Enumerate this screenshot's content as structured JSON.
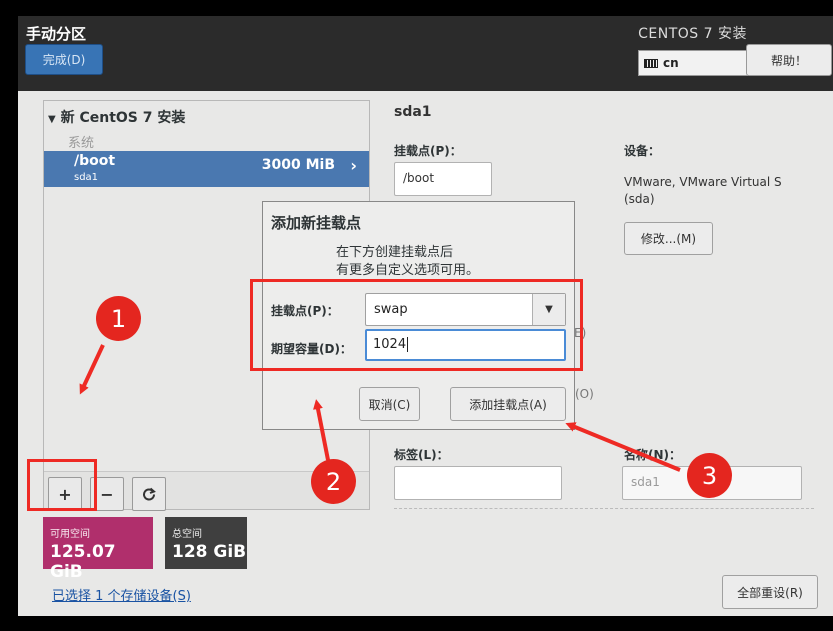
{
  "header": {
    "title": "手动分区",
    "done_label": "完成(D)",
    "product_title": "CENTOS 7 安装",
    "keyboard_layout": "cn",
    "help_label": "帮助！"
  },
  "left_panel": {
    "group_title": "新 CentOS 7 安装",
    "section_label": "系统",
    "selected_row": {
      "mount": "/boot",
      "device": "sda1",
      "size": "3000 MiB"
    },
    "tools": {
      "add": "+",
      "remove": "−"
    }
  },
  "space": {
    "available_label": "可用空间",
    "available_value": "125.07 GiB",
    "total_label": "总空间",
    "total_value": "128 GiB"
  },
  "storage_link": "已选择 1 个存储设备(S)",
  "reset_label": "全部重设(R)",
  "right_panel": {
    "title": "sda1",
    "mount_label": "挂载点(P)：",
    "mount_value": "/boot",
    "device_label": "设备：",
    "device_desc_line1": "VMware, VMware Virtual S",
    "device_desc_line2": "(sda)",
    "modify_label": "修改...(M)",
    "frag_e": "E)",
    "frag_o": "(O)",
    "tag_label": "标签(L)：",
    "name_label": "名称(N)：",
    "name_value": "sda1"
  },
  "dialog": {
    "title": "添加新挂载点",
    "desc_line1": "在下方创建挂载点后",
    "desc_line2": "有更多自定义选项可用。",
    "mount_label": "挂载点(P)：",
    "mount_value": "swap",
    "capacity_label": "期望容量(D)：",
    "capacity_value": "1024",
    "cancel_label": "取消(C)",
    "add_label": "添加挂载点(A)"
  },
  "annotations": {
    "step1": "1",
    "step2": "2",
    "step3": "3"
  },
  "colors": {
    "annotation_red": "#ee2a24",
    "selection_blue": "#4a78b0",
    "available_magenta": "#b02f6c",
    "done_blue": "#3874b5"
  }
}
